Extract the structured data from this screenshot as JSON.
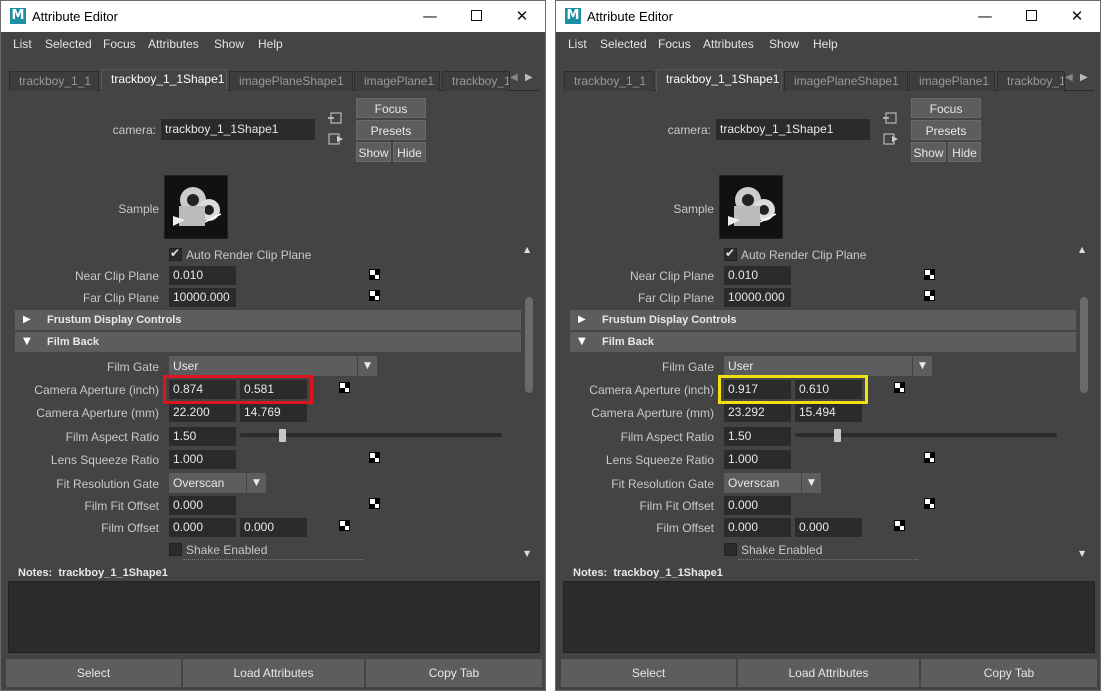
{
  "windows": [
    {
      "title": "Attribute Editor",
      "menu": [
        "List",
        "Selected",
        "Focus",
        "Attributes",
        "Show",
        "Help"
      ],
      "tabs": [
        "trackboy_1_1",
        "trackboy_1_1Shape1",
        "imagePlaneShape1",
        "imagePlane1",
        "trackboy_1_"
      ],
      "camera_label": "camera:",
      "camera_value": "trackboy_1_1Shape1",
      "focus_label": "Focus",
      "presets_label": "Presets",
      "show_label": "Show",
      "hide_label": "Hide",
      "sample_label": "Sample",
      "auto_render_clip_plane": "Auto Render Clip Plane",
      "near_clip_label": "Near Clip Plane",
      "near_clip_value": "0.010",
      "far_clip_label": "Far Clip Plane",
      "far_clip_value": "10000.000",
      "frustum_section": "Frustum Display Controls",
      "film_back_section": "Film Back",
      "film_gate_label": "Film Gate",
      "film_gate_value": "User",
      "cam_ap_inch_label": "Camera Aperture (inch)",
      "cam_ap_inch_x": "0.874",
      "cam_ap_inch_y": "0.581",
      "cam_ap_mm_label": "Camera Aperture (mm)",
      "cam_ap_mm_x": "22.200",
      "cam_ap_mm_y": "14.769",
      "film_aspect_label": "Film Aspect Ratio",
      "film_aspect_value": "1.50",
      "lens_squeeze_label": "Lens Squeeze Ratio",
      "lens_squeeze_value": "1.000",
      "fit_res_gate_label": "Fit Resolution Gate",
      "fit_res_gate_value": "Overscan",
      "film_fit_offset_label": "Film Fit Offset",
      "film_fit_offset_value": "0.000",
      "film_offset_label": "Film Offset",
      "film_offset_x": "0.000",
      "film_offset_y": "0.000",
      "shake_enabled": "Shake Enabled",
      "notes_prefix": "Notes:",
      "notes_node": "trackboy_1_1Shape1",
      "select_label": "Select",
      "load_attributes_label": "Load Attributes",
      "copy_tab_label": "Copy Tab",
      "highlight_color": "#e0141c"
    },
    {
      "title": "Attribute Editor",
      "menu": [
        "List",
        "Selected",
        "Focus",
        "Attributes",
        "Show",
        "Help"
      ],
      "tabs": [
        "trackboy_1_1",
        "trackboy_1_1Shape1",
        "imagePlaneShape1",
        "imagePlane1",
        "trackboy_1_"
      ],
      "camera_label": "camera:",
      "camera_value": "trackboy_1_1Shape1",
      "focus_label": "Focus",
      "presets_label": "Presets",
      "show_label": "Show",
      "hide_label": "Hide",
      "sample_label": "Sample",
      "auto_render_clip_plane": "Auto Render Clip Plane",
      "near_clip_label": "Near Clip Plane",
      "near_clip_value": "0.010",
      "far_clip_label": "Far Clip Plane",
      "far_clip_value": "10000.000",
      "frustum_section": "Frustum Display Controls",
      "film_back_section": "Film Back",
      "film_gate_label": "Film Gate",
      "film_gate_value": "User",
      "cam_ap_inch_label": "Camera Aperture (inch)",
      "cam_ap_inch_x": "0.917",
      "cam_ap_inch_y": "0.610",
      "cam_ap_mm_label": "Camera Aperture (mm)",
      "cam_ap_mm_x": "23.292",
      "cam_ap_mm_y": "15.494",
      "film_aspect_label": "Film Aspect Ratio",
      "film_aspect_value": "1.50",
      "lens_squeeze_label": "Lens Squeeze Ratio",
      "lens_squeeze_value": "1.000",
      "fit_res_gate_label": "Fit Resolution Gate",
      "fit_res_gate_value": "Overscan",
      "film_fit_offset_label": "Film Fit Offset",
      "film_fit_offset_value": "0.000",
      "film_offset_label": "Film Offset",
      "film_offset_x": "0.000",
      "film_offset_y": "0.000",
      "shake_enabled": "Shake Enabled",
      "notes_prefix": "Notes:",
      "notes_node": "trackboy_1_1Shape1",
      "select_label": "Select",
      "load_attributes_label": "Load Attributes",
      "copy_tab_label": "Copy Tab",
      "highlight_color": "#f0e010"
    }
  ]
}
